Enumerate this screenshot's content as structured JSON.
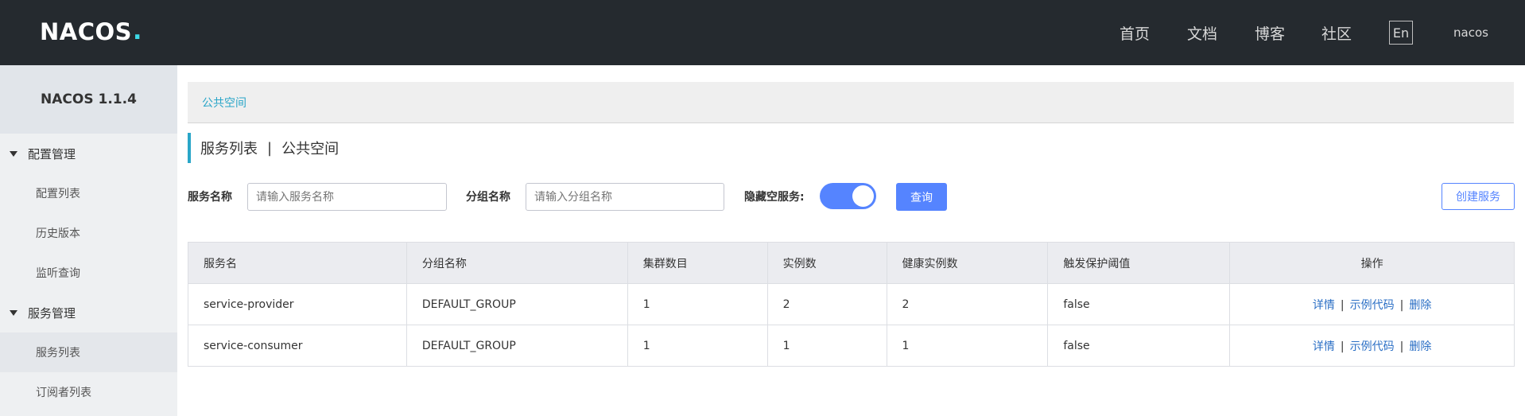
{
  "header": {
    "logo_text": "NACOS",
    "logo_dot": ".",
    "nav": [
      "首页",
      "文档",
      "博客",
      "社区"
    ],
    "lang": "En",
    "user": "nacos"
  },
  "sidebar": {
    "version": "NACOS 1.1.4",
    "groups": [
      {
        "label": "配置管理",
        "items": [
          "配置列表",
          "历史版本",
          "监听查询"
        ]
      },
      {
        "label": "服务管理",
        "items": [
          "服务列表",
          "订阅者列表"
        ]
      }
    ],
    "active_item": "服务列表"
  },
  "breadcrumb": "公共空间",
  "page_title": {
    "main": "服务列表",
    "separator": "|",
    "namespace": "公共空间"
  },
  "filters": {
    "service_label": "服务名称",
    "service_placeholder": "请输入服务名称",
    "group_label": "分组名称",
    "group_placeholder": "请输入分组名称",
    "hide_empty_label": "隐藏空服务:",
    "hide_empty_on": true,
    "query_button": "查询",
    "create_button": "创建服务"
  },
  "table": {
    "columns": [
      "服务名",
      "分组名称",
      "集群数目",
      "实例数",
      "健康实例数",
      "触发保护阈值",
      "操作"
    ],
    "rows": [
      {
        "name": "service-provider",
        "group": "DEFAULT_GROUP",
        "clusters": "1",
        "instances": "2",
        "healthy": "2",
        "protect": "false"
      },
      {
        "name": "service-consumer",
        "group": "DEFAULT_GROUP",
        "clusters": "1",
        "instances": "1",
        "healthy": "1",
        "protect": "false"
      }
    ],
    "actions": {
      "detail": "详情",
      "sample": "示例代码",
      "delete": "删除",
      "sep": "|"
    }
  },
  "colors": {
    "header_bg": "#252a2f",
    "accent": "#2aa6c8",
    "primary": "#5584ff",
    "link": "#2b6fc5"
  }
}
